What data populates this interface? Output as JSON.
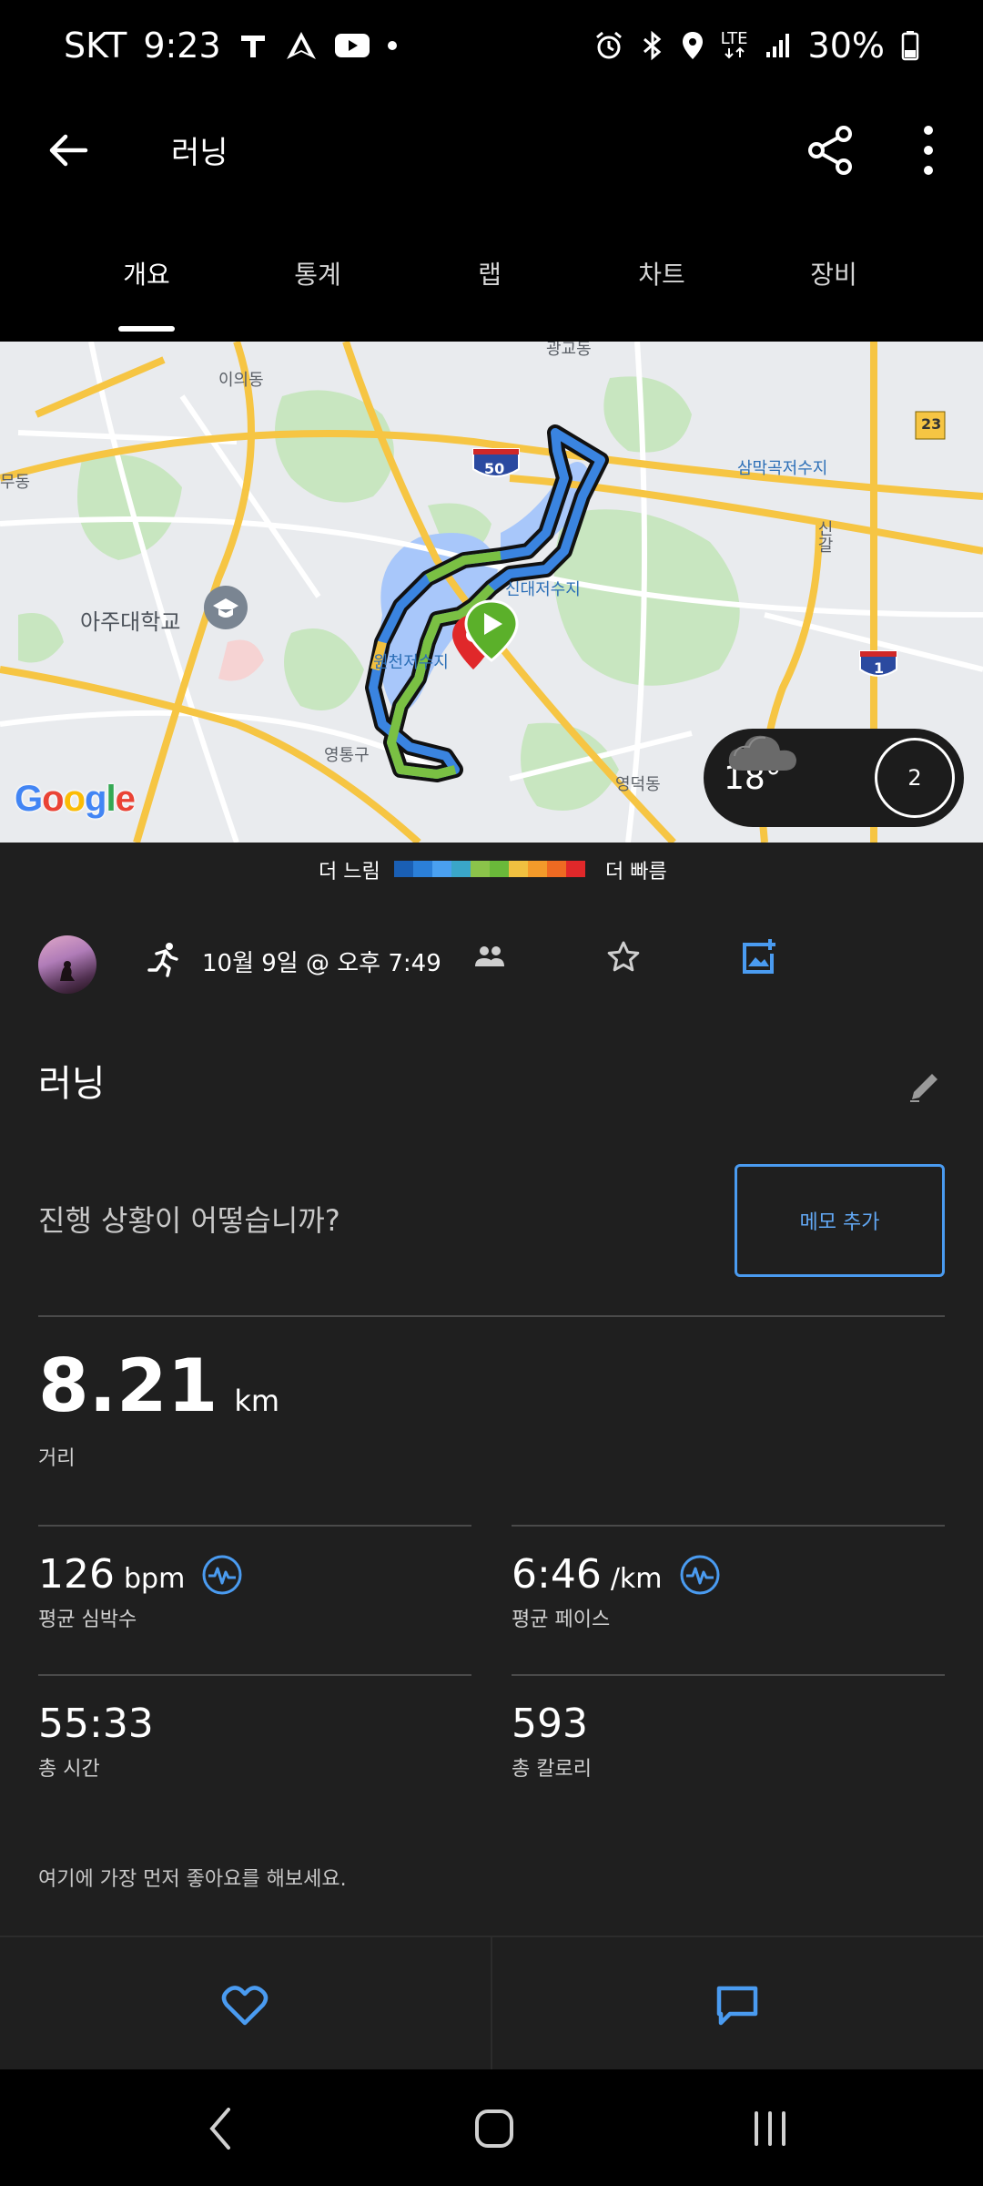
{
  "status_bar": {
    "carrier": "SKT",
    "time": "9:23",
    "network": "LTE",
    "battery": "30%"
  },
  "app_bar": {
    "title": "러닝"
  },
  "tabs": [
    {
      "label": "개요",
      "active": true
    },
    {
      "label": "통계",
      "active": false
    },
    {
      "label": "랩",
      "active": false
    },
    {
      "label": "차트",
      "active": false
    },
    {
      "label": "장비",
      "active": false
    }
  ],
  "map": {
    "labels": {
      "l1": "이의동",
      "l2": "삼막곡저수지",
      "l3": "신대저수지",
      "l4": "아주대학교",
      "l5": "원천저수지",
      "l6": "영통구",
      "l7": "영덕동",
      "l8": "광교동",
      "l9": "무동",
      "l10": "신갈",
      "r50": "50",
      "r23": "23",
      "r1": "1"
    },
    "google_logo": "Google",
    "weather": {
      "temp": "18°",
      "wind": "2"
    }
  },
  "legend": {
    "slow": "더 느림",
    "fast": "더 빠름",
    "colors": [
      "#1a5fb4",
      "#2b7fd8",
      "#4aa0f0",
      "#3aa6c8",
      "#8bc34a",
      "#6ab93a",
      "#f0c040",
      "#f39a2a",
      "#ee6a22",
      "#e0282a"
    ]
  },
  "activity": {
    "date": "10월 9일 @ 오후 7:49",
    "name": "러닝",
    "memo_question": "진행 상황이 어떻습니까?",
    "memo_button": "메모 추가"
  },
  "stats": {
    "distance": {
      "value": "8.21",
      "unit": "km",
      "label": "거리"
    },
    "heart_rate": {
      "value": "126",
      "unit": "bpm",
      "label": "평균 심박수"
    },
    "pace": {
      "value": "6:46",
      "unit": "/km",
      "label": "평균 페이스"
    },
    "time": {
      "value": "55:33",
      "label": "총 시간"
    },
    "calories": {
      "value": "593",
      "label": "총 칼로리"
    }
  },
  "like_prompt": "여기에 가장 먼저 좋아요를 해보세요.",
  "colors": {
    "accent_blue": "#4a9bf0",
    "background": "#1f1f1f"
  }
}
